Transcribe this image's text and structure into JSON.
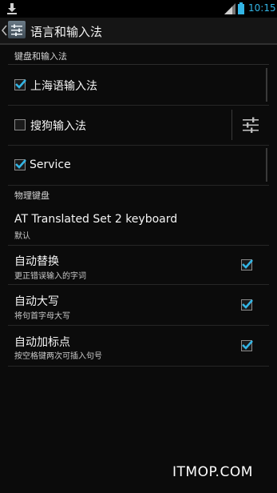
{
  "status_bar": {
    "time": "10:15",
    "accent": "#33b5e5"
  },
  "action_bar": {
    "title": "语言和输入法",
    "icons": [
      "up-arrow-icon",
      "app-settings-icon"
    ]
  },
  "keyboard_section": {
    "header": "键盘和输入法",
    "items": [
      {
        "label": "上海语输入法",
        "checked": true
      },
      {
        "label": "搜狗输入法",
        "checked": false,
        "has_settings": true
      },
      {
        "label": "Service",
        "checked": true
      }
    ]
  },
  "physical_section": {
    "header": "物理键盘",
    "keyboard": {
      "title": "AT Translated Set 2 keyboard",
      "summary": "默认"
    },
    "options": [
      {
        "title": "自动替换",
        "summary": "更正错误输入的字词",
        "checked": true
      },
      {
        "title": "自动大写",
        "summary": "将句首字母大写",
        "checked": true
      },
      {
        "title": "自动加标点",
        "summary": "按空格键两次可插入句号",
        "checked": true
      }
    ]
  },
  "watermark": "ITMOP.COM"
}
